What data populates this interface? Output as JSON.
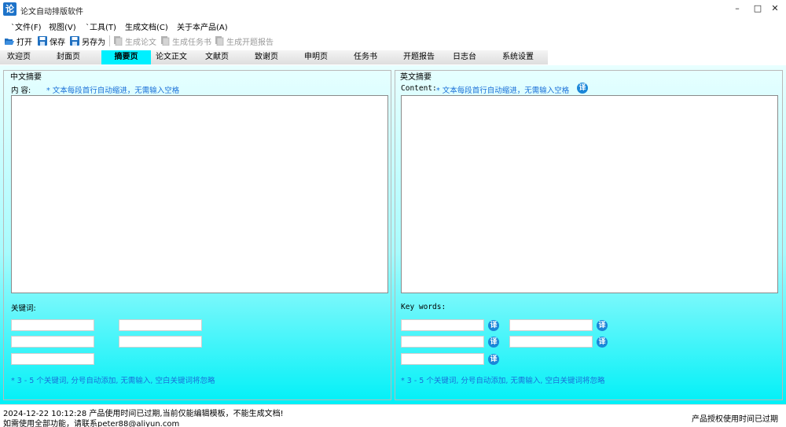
{
  "window": {
    "title": "论文自动排版软件",
    "app_icon_char": "论",
    "minimize": "–",
    "maximize": "□",
    "close": "✕"
  },
  "menu": [
    "`文件(F)",
    "视图(V)",
    "`工具(T)",
    "生成文档(C)",
    "关于本产品(A)"
  ],
  "toolbar": {
    "open": "打开",
    "save": "保存",
    "save_as": "另存为",
    "gen_paper": "生成论文",
    "gen_task": "生成任务书",
    "gen_proposal": "生成开题报告"
  },
  "tabs": [
    "欢迎页",
    "封面页",
    "摘要页",
    "论文正文",
    "文献页",
    "致谢页",
    "申明页",
    "任务书",
    "开题报告",
    "日志台",
    "系统设置"
  ],
  "active_tab": "摘要页",
  "chinese_abstract": {
    "group_title": "中文摘要",
    "content_label": "内  容:",
    "content_hint": "* 文本每段首行自动缩进，无需输入空格",
    "content_value": "",
    "keywords_label": "关键词:",
    "keywords": [
      "",
      "",
      "",
      "",
      ""
    ],
    "keywords_hint": "* 3 - 5 个关键词, 分号自动添加, 无需输入, 空白关键词将忽略"
  },
  "english_abstract": {
    "group_title": "英文摘要",
    "content_label": "Content:",
    "content_hint": "* 文本每段首行自动缩进，无需输入空格",
    "translate_label": "译",
    "content_value": "",
    "keywords_label": "Key words:",
    "keywords": [
      "",
      "",
      "",
      "",
      ""
    ],
    "keywords_hint": "* 3 - 5 个关键词, 分号自动添加, 无需输入, 空白关键词将忽略"
  },
  "status": {
    "line1": "2024-12-22 10:12:28  产品使用时间已过期,当前仅能编辑模板，不能生成文档!",
    "line2": "如需使用全部功能，请联系peter88@aliyun.com",
    "right": "产品授权使用时间已过期"
  },
  "colors": {
    "accent": "#00f0ff",
    "hint": "#1a6fd8",
    "translate_btn": "#1a86d8"
  },
  "icons": {
    "open": "folder-open-icon",
    "save": "floppy-disk-icon",
    "save_as": "floppy-disk-icon",
    "generate": "document-icon"
  }
}
